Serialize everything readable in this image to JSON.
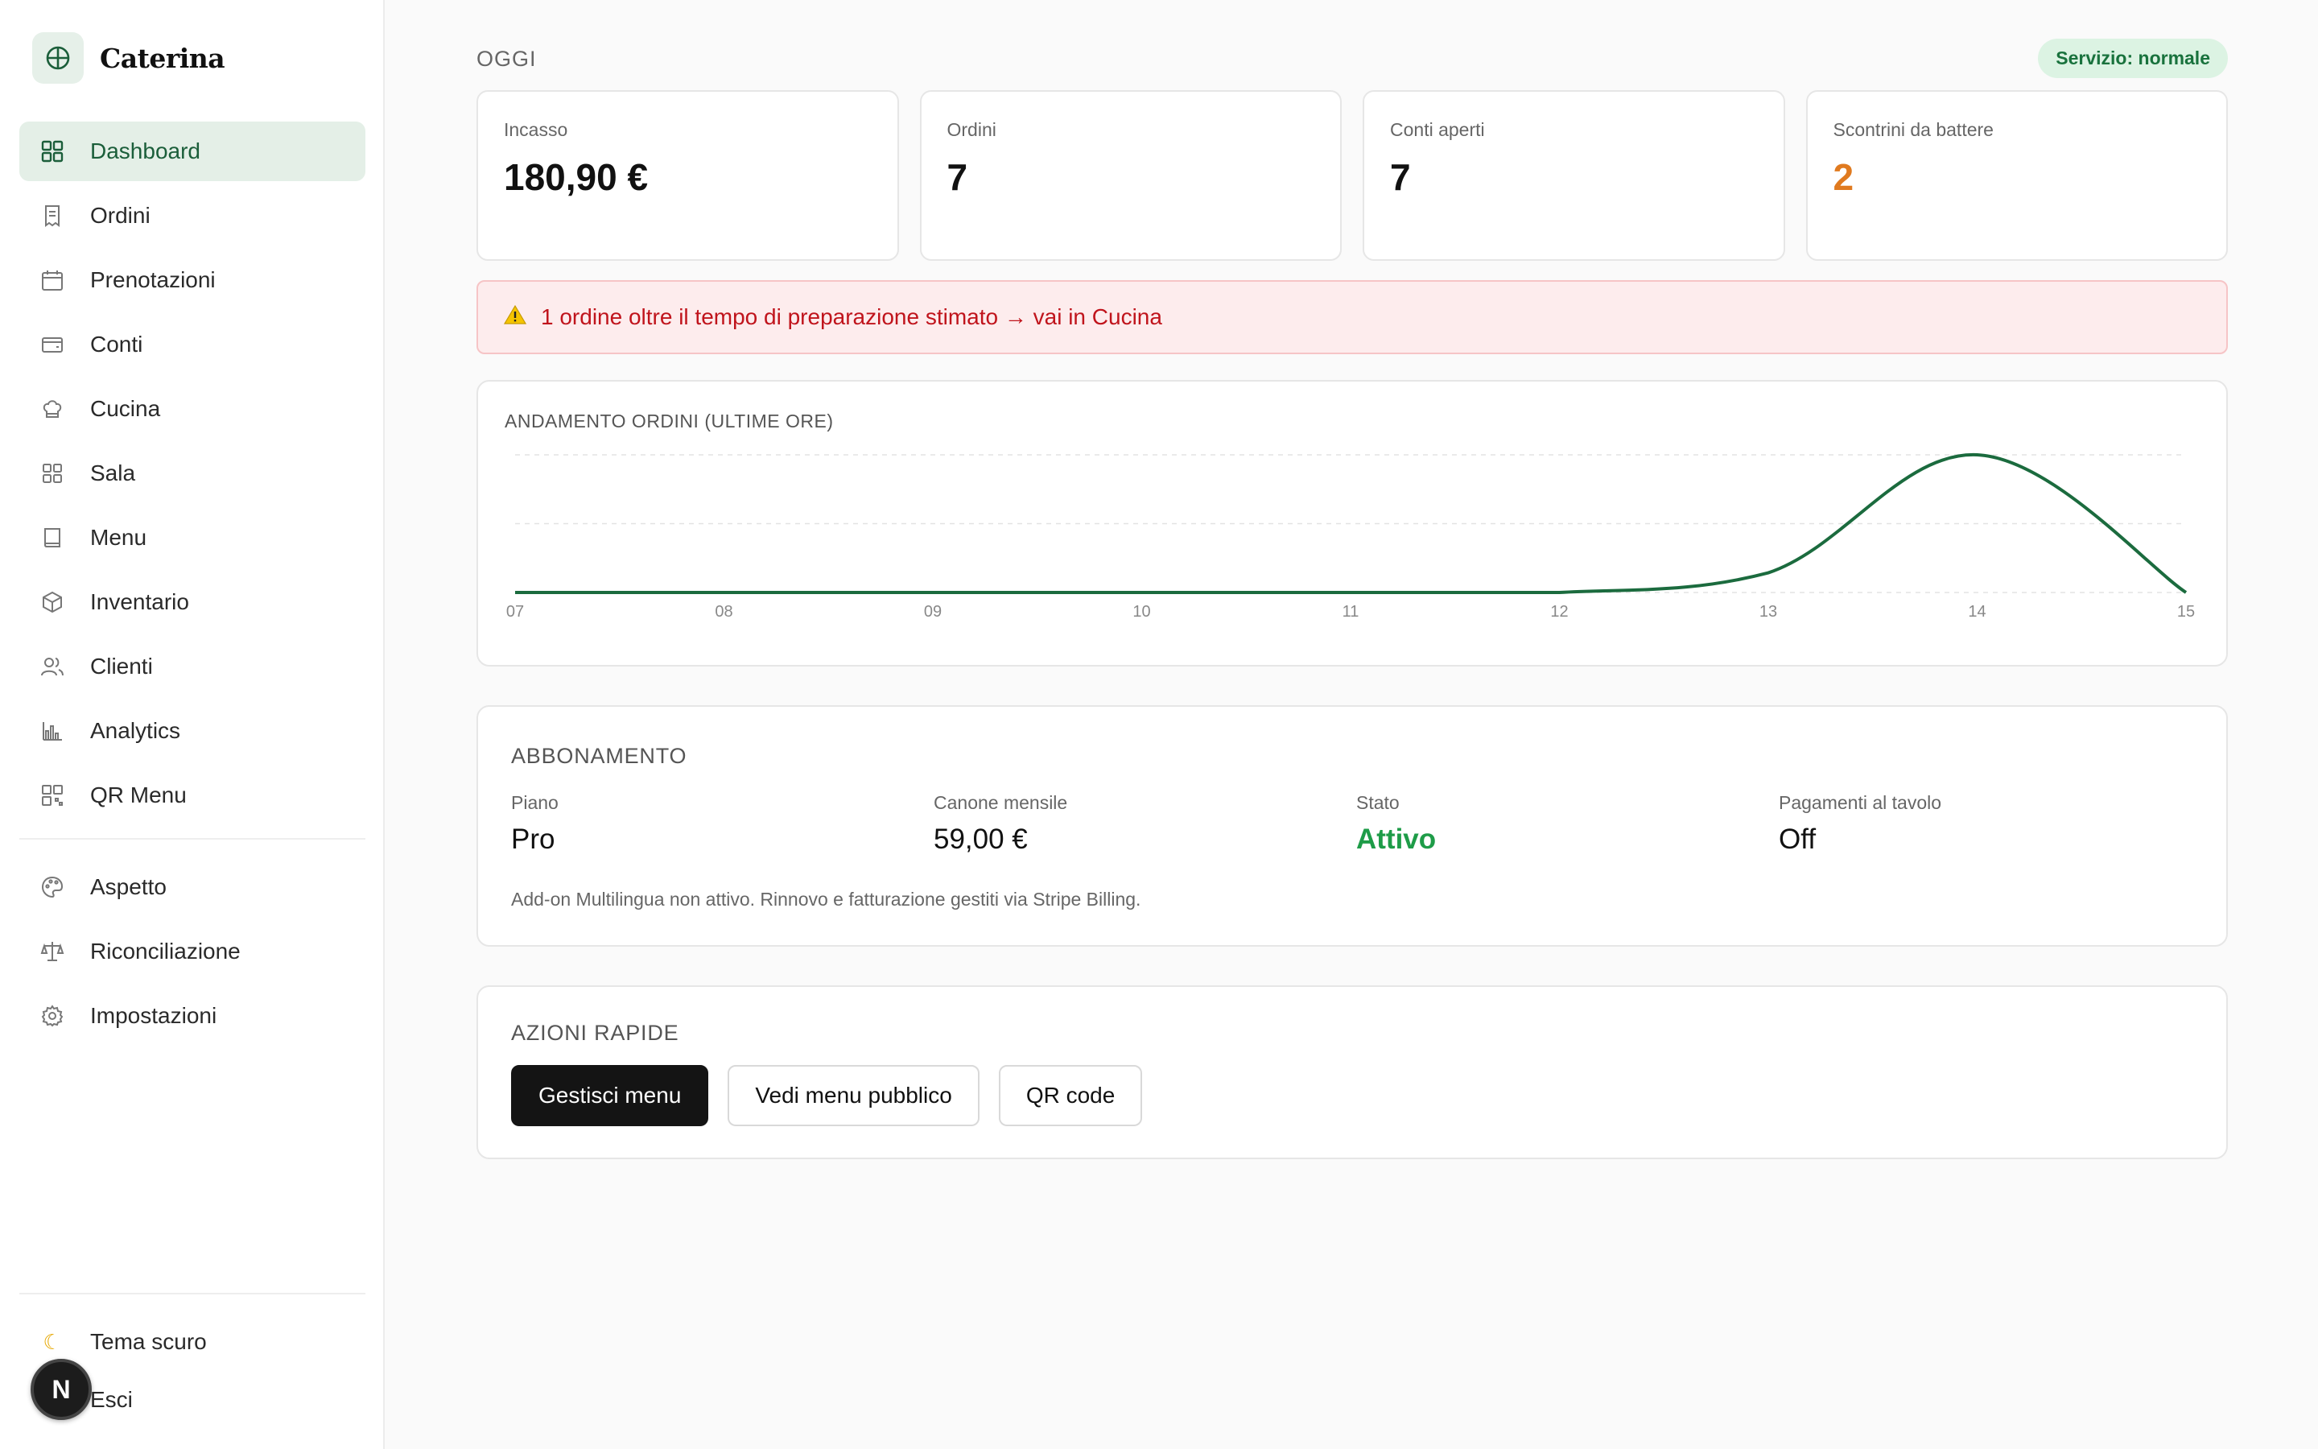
{
  "brand": {
    "name": "Caterina"
  },
  "sidebar": {
    "items": [
      {
        "label": "Dashboard",
        "icon": "grid-icon",
        "active": true
      },
      {
        "label": "Ordini",
        "icon": "receipt-icon"
      },
      {
        "label": "Prenotazioni",
        "icon": "calendar-icon"
      },
      {
        "label": "Conti",
        "icon": "wallet-icon"
      },
      {
        "label": "Cucina",
        "icon": "chef-hat-icon"
      },
      {
        "label": "Sala",
        "icon": "layout-icon"
      },
      {
        "label": "Menu",
        "icon": "book-icon"
      },
      {
        "label": "Inventario",
        "icon": "box-icon"
      },
      {
        "label": "Clienti",
        "icon": "users-icon"
      },
      {
        "label": "Analytics",
        "icon": "bar-chart-icon"
      },
      {
        "label": "QR Menu",
        "icon": "qr-icon"
      }
    ],
    "secondary": [
      {
        "label": "Aspetto",
        "icon": "palette-icon"
      },
      {
        "label": "Riconciliazione",
        "icon": "scale-icon"
      },
      {
        "label": "Impostazioni",
        "icon": "gear-icon"
      }
    ],
    "bottom": [
      {
        "label": "Tema scuro",
        "icon": "moon-icon"
      },
      {
        "label": "Esci",
        "icon": "logout-icon"
      }
    ],
    "user_badge": "N"
  },
  "today": {
    "title": "OGGI",
    "service_badge": "Servizio: normale",
    "kpis": [
      {
        "label": "Incasso",
        "value": "180,90 €"
      },
      {
        "label": "Ordini",
        "value": "7"
      },
      {
        "label": "Conti aperti",
        "value": "7"
      },
      {
        "label": "Scontrini da battere",
        "value": "2"
      }
    ]
  },
  "alert": {
    "icon": "warning-icon",
    "text": "1 ordine oltre il tempo di preparazione stimato → vai in Cucina"
  },
  "chart": {
    "title": "ANDAMENTO ORDINI (ULTIME ORE)"
  },
  "chart_data": {
    "type": "line",
    "title": "ANDAMENTO ORDINI (ULTIME ORE)",
    "categories": [
      "07",
      "08",
      "09",
      "10",
      "11",
      "12",
      "13",
      "14",
      "15"
    ],
    "series": [
      {
        "values": [
          0,
          0,
          0,
          0,
          0,
          0,
          1,
          7,
          0
        ]
      }
    ],
    "ylim": [
      0,
      7
    ],
    "grid": true,
    "color": "#1b6b3e"
  },
  "subscription": {
    "heading": "ABBONAMENTO",
    "fields": [
      {
        "label": "Piano",
        "value": "Pro"
      },
      {
        "label": "Canone mensile",
        "value": "59,00 €"
      },
      {
        "label": "Stato",
        "value": "Attivo"
      },
      {
        "label": "Pagamenti al tavolo",
        "value": "Off"
      }
    ],
    "note": "Add-on Multilingua non attivo. Rinnovo e fatturazione gestiti via Stripe Billing."
  },
  "quick_actions": {
    "heading": "AZIONI RAPIDE",
    "buttons": [
      {
        "label": "Gestisci menu"
      },
      {
        "label": "Vedi menu pubblico"
      },
      {
        "label": "QR code"
      }
    ]
  },
  "colors": {
    "accent": "#1b6b3e",
    "active_bg": "#e4efe7",
    "warning_value": "#e07a1f",
    "alert_text": "#c0141c",
    "status_ok": "#1e9c48"
  }
}
